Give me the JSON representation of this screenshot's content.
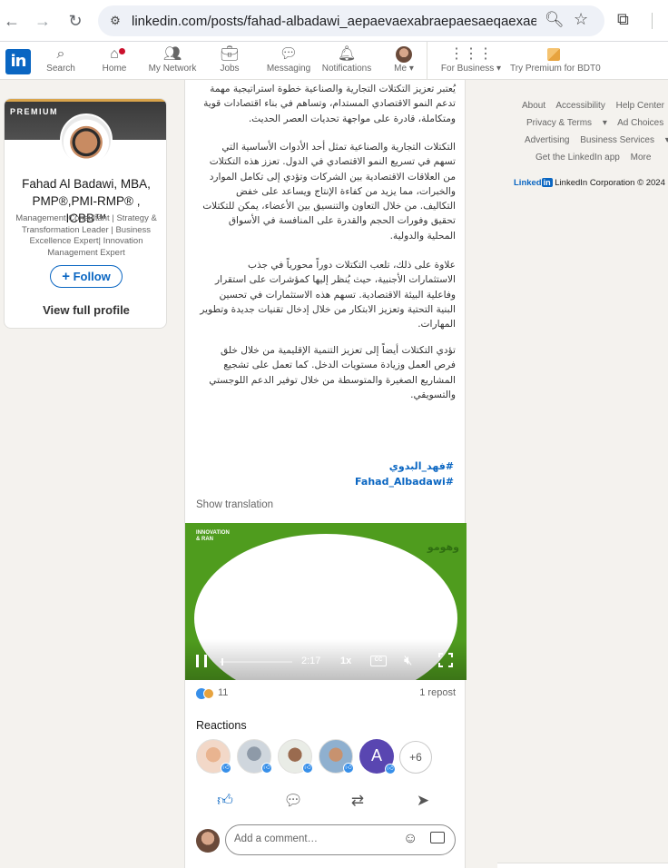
{
  "browser": {
    "url": "linkedin.com/posts/fahad-albadawi_aepaevaexabraepaesaeqaexaewa..."
  },
  "nav": {
    "items": [
      {
        "label": "Search"
      },
      {
        "label": "Home"
      },
      {
        "label": "My Network"
      },
      {
        "label": "Jobs"
      },
      {
        "label": "Messaging"
      },
      {
        "label": "Notifications"
      },
      {
        "label": "Me"
      },
      {
        "label": "For Business"
      },
      {
        "label": "Try Premium for BDT0"
      }
    ]
  },
  "profile": {
    "premium_label": "PREMIUM",
    "name": "Fahad Al Badawi, MBA, PMP®,PMI-RMP® , ICBB™",
    "headline": "Management Consultant | Strategy & Transformation Leader | Business Excellence Expert| Innovation Management Expert",
    "follow_label": "Follow",
    "view_profile_label": "View full profile"
  },
  "post": {
    "paragraphs": [
      "يُعتبر تعزيز التكتلات التجارية والصناعية خطوة استراتيجية مهمة تدعم النمو الاقتصادي المستدام، وتساهم في بناء اقتصادات قوية ومتكاملة، قادرة على مواجهة تحديات العصر الحديث.",
      "التكتلات التجارية والصناعية تمثل أحد الأدوات الأساسية التي تسهم في تسريع النمو الاقتصادي في الدول. تعزز هذه التكتلات من العلاقات الاقتصادية بين الشركات وتؤدي إلى تكامل الموارد والخبرات، مما يزيد من كفاءة الإنتاج ويساعد على خفض التكاليف. من خلال التعاون والتنسيق بين الأعضاء، يمكن للتكتلات تحقيق وفورات الحجم والقدرة على المنافسة في الأسواق المحلية والدولية.",
      "علاوة على ذلك، تلعب التكتلات دوراً محورياً في جذب الاستثمارات الأجنبية، حيث يُنظر إليها كمؤشرات على استقرار وفاعلية البيئة الاقتصادية. تسهم هذه الاستثمارات في تحسين البنية التحتية وتعزيز الابتكار من خلال إدخال تقنيات جديدة وتطوير المهارات.",
      "تؤدي التكتلات أيضاً إلى تعزيز التنمية الإقليمية من خلال خلق فرص العمل وزيادة مستويات الدخل. كما تعمل على تشجيع المشاريع الصغيرة والمتوسطة من خلال توفير الدعم اللوجستي والتسويقي."
    ],
    "hashtags": [
      "#فهد_البدوي",
      "#Fahad_Albadawi"
    ],
    "show_translation": "Show translation",
    "video": {
      "logo_left": "INNOVATION & RAN",
      "logo_right": "وهومو",
      "time": "2:17",
      "speed": "1x",
      "cc": "CC",
      "progress": 0.02
    },
    "reaction_count": "11",
    "repost_count": "1 repost",
    "reactions_title": "Reactions",
    "more_reactors": "+6",
    "reactor_initial": "A",
    "comment_placeholder": "Add a comment…"
  },
  "footer": {
    "links_row1": [
      "About",
      "Accessibility",
      "Help Center"
    ],
    "links_row2": [
      "Privacy & Terms",
      "Ad Choices"
    ],
    "links_row3": [
      "Advertising",
      "Business Services"
    ],
    "links_row4": [
      "Get the LinkedIn app",
      "More"
    ],
    "brand": "Linked",
    "brand_in": "in",
    "copyright": "LinkedIn Corporation © 2024"
  },
  "colors": {
    "accent": "#0a66c2",
    "video_green": "#4f9c1e"
  }
}
